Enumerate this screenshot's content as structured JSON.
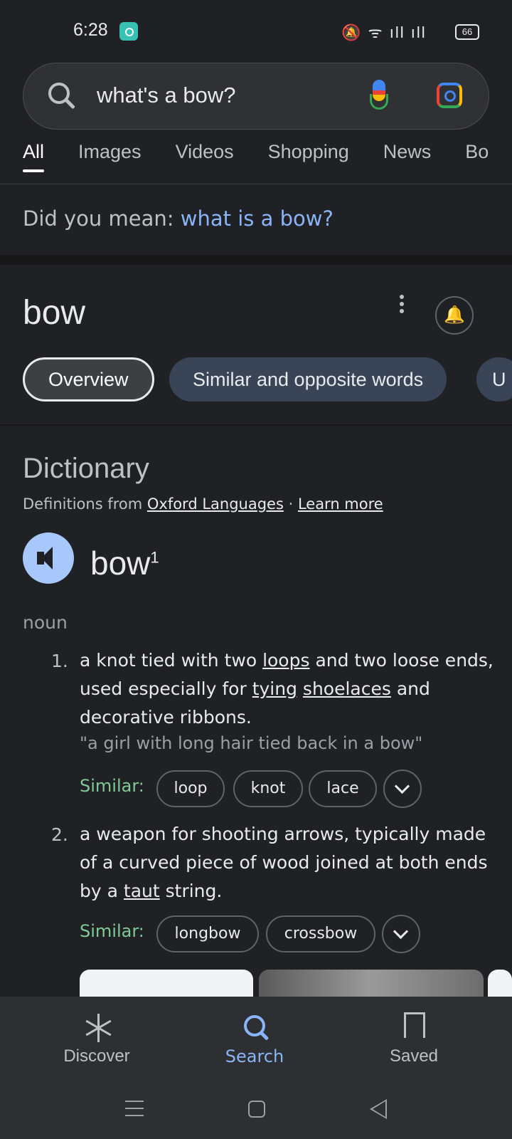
{
  "status": {
    "time": "6:28",
    "battery": "66"
  },
  "search": {
    "query": "what's a bow?"
  },
  "tabs": [
    {
      "label": "All"
    },
    {
      "label": "Images"
    },
    {
      "label": "Videos"
    },
    {
      "label": "Shopping"
    },
    {
      "label": "News"
    },
    {
      "label": "Bo"
    }
  ],
  "did_you_mean": {
    "prefix": "Did you mean: ",
    "suggestion": "what is a bow?"
  },
  "knowledge": {
    "title": "bow",
    "chips": [
      {
        "label": "Overview"
      },
      {
        "label": "Similar and opposite words"
      },
      {
        "label": "U"
      }
    ]
  },
  "dictionary": {
    "heading": "Dictionary",
    "source_prefix": "Definitions from ",
    "source_link": "Oxford Languages",
    "source_sep": " · ",
    "learn_more": "Learn more",
    "word": "bow",
    "superscript": "1",
    "part_of_speech": "noun",
    "similar_label": "Similar:",
    "definitions": [
      {
        "number": "1.",
        "line1_a": "a knot tied with two ",
        "line1_link": "loops",
        "line1_b": " and two loose ends,",
        "line2_a": "used especially for ",
        "line2_link1": "tying",
        "line2_link2": "shoelaces",
        "line2_b": " and",
        "line3": "decorative ribbons.",
        "example": "\"a girl with long hair tied back in a bow\"",
        "similar": [
          "loop",
          "knot",
          "lace"
        ]
      },
      {
        "number": "2.",
        "line1": "a weapon for shooting arrows, typically made",
        "line2": "of a curved piece of wood joined at both ends",
        "line3_a": "by a ",
        "line3_link": "taut",
        "line3_b": " string.",
        "similar": [
          "longbow",
          "crossbow"
        ]
      }
    ]
  },
  "bottom_nav": [
    {
      "label": "Discover"
    },
    {
      "label": "Search"
    },
    {
      "label": "Saved"
    }
  ]
}
